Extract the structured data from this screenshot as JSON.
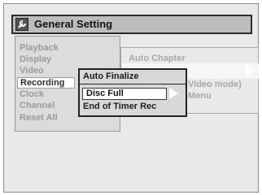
{
  "header": {
    "title": "General Setting"
  },
  "left_menu": {
    "items": [
      {
        "label": "Playback"
      },
      {
        "label": "Display"
      },
      {
        "label": "Video"
      },
      {
        "label": "Recording"
      },
      {
        "label": "Clock"
      },
      {
        "label": "Channel"
      },
      {
        "label": "Reset All"
      }
    ],
    "selected_index": 3
  },
  "middle_panel": {
    "item1": "Auto Chapter",
    "item2": "Video mode)",
    "item3": "Menu"
  },
  "popup": {
    "title": "Auto Finalize",
    "options": [
      {
        "label": "Disc Full"
      },
      {
        "label": "End of Timer Rec"
      }
    ],
    "selected_index": 0
  },
  "icons": {
    "title": "wrench-icon",
    "submenu": "triangle-right-icon"
  },
  "colors": {
    "background": "#e9e9e9",
    "titlebar": "#bdbdbd",
    "selection": "#ffffff"
  }
}
